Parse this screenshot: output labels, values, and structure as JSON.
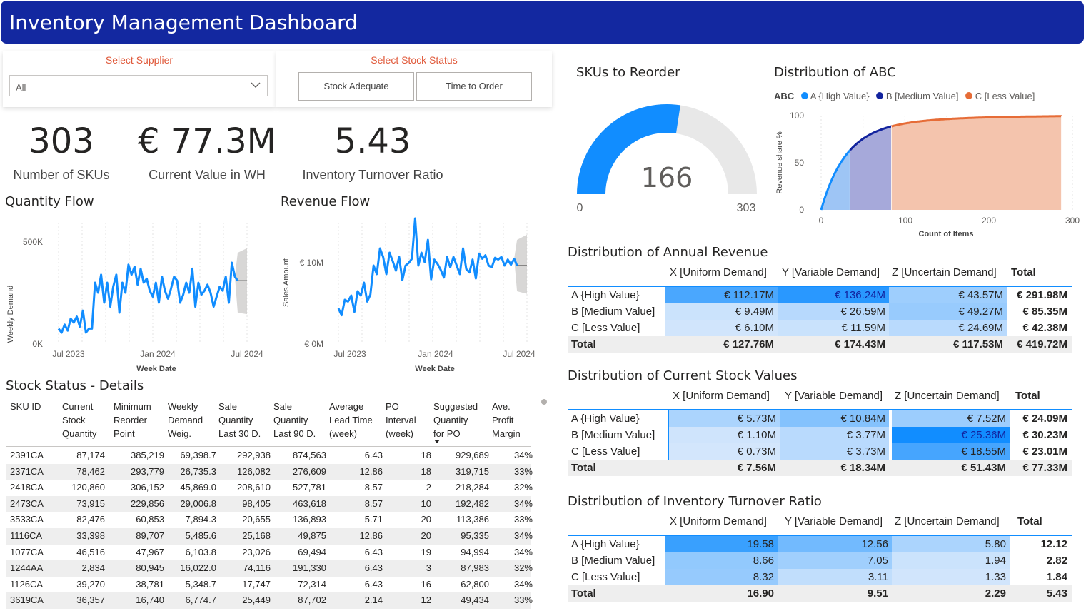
{
  "header": {
    "title": "Inventory Management Dashboard"
  },
  "slicers": {
    "supplier": {
      "title": "Select Supplier",
      "value": "All"
    },
    "stock_status": {
      "title": "Select Stock Status",
      "options": [
        "Stock Adequate",
        "Time to Order"
      ]
    }
  },
  "kpis": [
    {
      "value": "303",
      "label": "Number of SKUs"
    },
    {
      "value": "€ 77.3M",
      "label": "Current Value in WH"
    },
    {
      "value": "5.43",
      "label": "Inventory Turnover Ratio"
    }
  ],
  "quantity_flow": {
    "title": "Quantity Flow",
    "ylabel": "Weekly Demand",
    "xlabel": "Week Date",
    "yticks": [
      "500K",
      "0K"
    ],
    "xticks": [
      "Jul 2023",
      "Jan 2024",
      "Jul 2024"
    ]
  },
  "revenue_flow": {
    "title": "Revenue Flow",
    "ylabel": "Sales Amount",
    "xlabel": "Week Date",
    "yticks": [
      "€ 10M",
      "€ 0M"
    ],
    "xticks": [
      "Jul 2023",
      "Jan 2024",
      "Jul 2024"
    ]
  },
  "gauge": {
    "title": "SKUs to Reorder",
    "value": "166",
    "min": "0",
    "max": "303",
    "fraction": 0.548,
    "color": "#118dff",
    "track": "#e8e8e8"
  },
  "abc": {
    "title": "Distribution of ABC",
    "legend_title": "ABC",
    "legend": [
      {
        "label": "A {High Value}",
        "color": "#118dff"
      },
      {
        "label": "B [Medium Value]",
        "color": "#12239e"
      },
      {
        "label": "C [Less Value]",
        "color": "#e66c37"
      }
    ],
    "ylabel": "Revenue share %",
    "xlabel": "Count of Items",
    "yticks": [
      "100",
      "50",
      "0"
    ],
    "xticks": [
      "0",
      "100",
      "200",
      "300"
    ]
  },
  "chart_data": [
    {
      "type": "line",
      "title": "Quantity Flow",
      "xlabel": "Week Date",
      "ylabel": "Weekly Demand",
      "ylim": [
        0,
        600000
      ],
      "x_start": "2023-07",
      "values": [
        70000,
        50000,
        90000,
        60000,
        120000,
        100000,
        130000,
        80000,
        160000,
        50000,
        70000,
        70000,
        300000,
        250000,
        340000,
        200000,
        300000,
        180000,
        280000,
        340000,
        150000,
        300000,
        250000,
        390000,
        340000,
        380000,
        290000,
        370000,
        300000,
        320000,
        260000,
        230000,
        300000,
        200000,
        330000,
        260000,
        220000,
        270000,
        330000,
        310000,
        200000,
        240000,
        300000,
        250000,
        370000,
        180000,
        300000,
        240000,
        260000,
        290000,
        250000,
        180000,
        230000,
        280000,
        260000,
        330000,
        200000,
        400000,
        330000
      ],
      "forecast": {
        "value": 310000,
        "low": 150000,
        "high": 450000,
        "weeks": 4
      }
    },
    {
      "type": "line",
      "title": "Revenue Flow",
      "xlabel": "Week Date",
      "ylabel": "Sales Amount",
      "ylim": [
        0,
        14000000
      ],
      "x_start": "2023-07",
      "values": [
        4000000,
        3200000,
        5000000,
        4800000,
        5500000,
        3600000,
        6000000,
        5500000,
        7000000,
        4800000,
        5600000,
        9000000,
        8000000,
        11000000,
        10000000,
        8000000,
        10500000,
        9500000,
        8400000,
        10000000,
        7300000,
        9000000,
        9300000,
        9800000,
        14500000,
        9000000,
        10500000,
        9400000,
        12000000,
        7400000,
        9700000,
        9200000,
        8500000,
        7600000,
        10000000,
        8800000,
        10000000,
        9000000,
        8000000,
        11000000,
        8600000,
        8200000,
        9700000,
        7500000,
        10400000,
        9800000,
        10200000,
        9000000,
        8800000,
        9900000,
        9700000,
        10000000,
        9000000,
        9700000,
        9100000,
        9800000
      ],
      "forecast": {
        "value": 9000000,
        "low": 6000000,
        "high": 12000000,
        "weeks": 4
      }
    },
    {
      "type": "area",
      "title": "Distribution of ABC",
      "xlabel": "Count of Items",
      "ylabel": "Revenue share %",
      "xlim": [
        0,
        303
      ],
      "ylim": [
        0,
        100
      ],
      "series": [
        {
          "name": "A {High Value}",
          "x_range": [
            0,
            35
          ],
          "y_end": 70
        },
        {
          "name": "B [Medium Value]",
          "x_range": [
            35,
            85
          ],
          "y_end": 90
        },
        {
          "name": "C [Less Value]",
          "x_range": [
            85,
            290
          ],
          "y_end": 100
        }
      ]
    }
  ],
  "stock_details": {
    "title": "Stock Status - Details",
    "columns": [
      [
        "SKU ID"
      ],
      [
        "Current",
        "Stock",
        "Quantity"
      ],
      [
        "Minimum",
        "Reorder",
        "Point"
      ],
      [
        "Weekly",
        "Demand",
        "Weig."
      ],
      [
        "Sale",
        "Quantity",
        "Last 30 D."
      ],
      [
        "Sale",
        "Quantity",
        "Last 90 D."
      ],
      [
        "Average",
        "Lead Time",
        "(week)"
      ],
      [
        "PO",
        "Interval",
        "(week)"
      ],
      [
        "Suggested",
        "Quantity",
        "for PO"
      ],
      [
        "Ave.",
        "Profit",
        "Margin"
      ]
    ],
    "rows": [
      [
        "2391CA",
        "87,174",
        "385,219",
        "69,398.7",
        "292,938",
        "874,563",
        "6.43",
        "18",
        "929,689",
        "34%"
      ],
      [
        "2371CA",
        "78,462",
        "293,779",
        "26,735.3",
        "126,082",
        "276,609",
        "12.86",
        "18",
        "319,715",
        "33%"
      ],
      [
        "2418CA",
        "120,860",
        "306,152",
        "45,869.0",
        "208,610",
        "527,781",
        "8.57",
        "2",
        "218,284",
        "32%"
      ],
      [
        "2473CA",
        "73,915",
        "229,856",
        "29,006.8",
        "98,405",
        "463,618",
        "8.57",
        "10",
        "192,482",
        "34%"
      ],
      [
        "3533CA",
        "82,476",
        "60,853",
        "7,894.3",
        "20,655",
        "136,893",
        "5.71",
        "20",
        "113,386",
        "33%"
      ],
      [
        "1116CA",
        "33,398",
        "89,707",
        "5,485.6",
        "25,168",
        "49,875",
        "12.86",
        "20",
        "95,335",
        "34%"
      ],
      [
        "1077CA",
        "46,516",
        "47,967",
        "6,103.8",
        "23,026",
        "69,494",
        "6.43",
        "19",
        "94,994",
        "34%"
      ],
      [
        "1244AA",
        "2,834",
        "80,945",
        "16,022.0",
        "74,116",
        "191,330",
        "6.43",
        "3",
        "87,983",
        "32%"
      ],
      [
        "1126CA",
        "39,270",
        "38,781",
        "5,348.7",
        "17,747",
        "72,314",
        "6.43",
        "16",
        "62,800",
        "34%"
      ],
      [
        "3619CA",
        "36,357",
        "16,740",
        "6,774.7",
        "25,449",
        "87,702",
        "2.14",
        "12",
        "49,434",
        "33%"
      ]
    ]
  },
  "matrices": [
    {
      "title": "Distribution of Annual Revenue",
      "headers": [
        "X [Uniform Demand]",
        "Y [Variable Demand]",
        "Z [Uncertain Demand]",
        "Total"
      ],
      "rows": [
        {
          "label": "A {High Value}",
          "values": [
            "€ 112.17M",
            "€ 136.24M",
            "€ 43.57M"
          ],
          "total": "€ 291.98M",
          "shades": [
            0.72,
            0.88,
            0.3
          ]
        },
        {
          "label": "B [Medium Value]",
          "values": [
            "€ 9.49M",
            "€ 26.59M",
            "€ 49.27M"
          ],
          "total": "€ 85.35M",
          "shades": [
            0.08,
            0.18,
            0.33
          ]
        },
        {
          "label": "C [Less Value]",
          "values": [
            "€ 6.10M",
            "€ 11.59M",
            "€ 24.69M"
          ],
          "total": "€ 42.38M",
          "shades": [
            0.05,
            0.09,
            0.17
          ]
        }
      ],
      "totals": {
        "label": "Total",
        "values": [
          "€ 127.76M",
          "€ 174.43M",
          "€ 117.53M"
        ],
        "total": "€ 419.72M"
      }
    },
    {
      "title": "Distribution of Current Stock Values",
      "headers": [
        "X [Uniform Demand]",
        "Y [Variable Demand]",
        "Z [Uncertain Demand]",
        "Total"
      ],
      "rows": [
        {
          "label": "A {High Value}",
          "values": [
            "€ 5.73M",
            "€ 10.84M",
            "€ 7.52M"
          ],
          "total": "€ 24.09M",
          "shades": [
            0.24,
            0.43,
            0.31
          ]
        },
        {
          "label": "B [Medium Value]",
          "values": [
            "€ 1.10M",
            "€ 3.77M",
            "€ 25.36M"
          ],
          "total": "€ 30.23M",
          "shades": [
            0.06,
            0.17,
            1.0
          ]
        },
        {
          "label": "C [Less Value]",
          "values": [
            "€ 0.73M",
            "€ 3.73M",
            "€ 18.55M"
          ],
          "total": "€ 23.01M",
          "shades": [
            0.04,
            0.17,
            0.74
          ]
        }
      ],
      "totals": {
        "label": "Total",
        "values": [
          "€ 7.56M",
          "€ 18.34M",
          "€ 51.43M"
        ],
        "total": "€ 77.33M"
      }
    },
    {
      "title": "Distribution of Inventory Turnover Ratio",
      "headers": [
        "X [Uniform Demand]",
        "Y [Variable Demand]",
        "Z [Uncertain Demand]",
        "Total"
      ],
      "rows": [
        {
          "label": "A {High Value}",
          "values": [
            "19.58",
            "12.56",
            "5.80"
          ],
          "total": "12.12",
          "shades": [
            0.8,
            0.52,
            0.24
          ]
        },
        {
          "label": "B [Medium Value]",
          "values": [
            "8.66",
            "7.05",
            "1.94"
          ],
          "total": "2.82",
          "shades": [
            0.36,
            0.29,
            0.08
          ]
        },
        {
          "label": "C [Less Value]",
          "values": [
            "8.32",
            "3.11",
            "1.33"
          ],
          "total": "1.84",
          "shades": [
            0.34,
            0.13,
            0.05
          ]
        }
      ],
      "totals": {
        "label": "Total",
        "values": [
          "16.90",
          "9.51",
          "2.29"
        ],
        "total": "5.43"
      }
    }
  ]
}
